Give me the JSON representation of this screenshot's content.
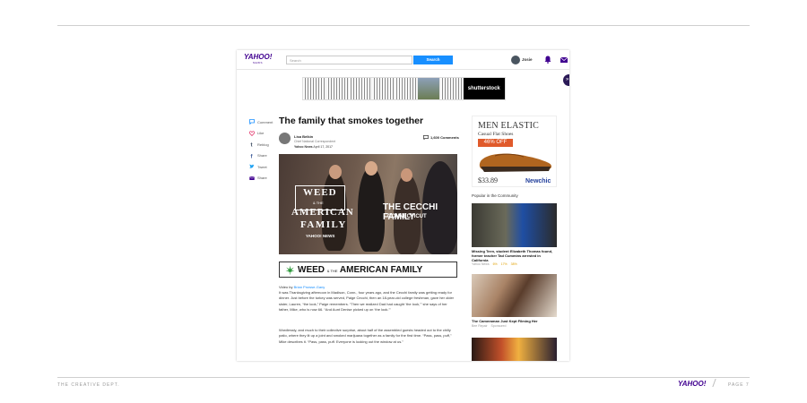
{
  "slide": {
    "footer_left": "THE CREATIVE DEPT.",
    "footer_logo": "YAHOO!",
    "footer_page": "PAGE 7"
  },
  "topbar": {
    "logo": "YAHOO!",
    "logo_sub": "NEWS",
    "search_placeholder": "Search",
    "search_button": "Search",
    "username": "Josie",
    "icons": [
      "bell-icon",
      "mail-icon"
    ]
  },
  "ad_banner": {
    "brand": "shutterstock",
    "close": "»"
  },
  "social": [
    {
      "label": "Comment",
      "icon": "comment-icon",
      "color": "#188fff"
    },
    {
      "label": "Like",
      "icon": "heart-icon",
      "color": "#e0245e"
    },
    {
      "label": "Reblog",
      "icon": "tumblr-icon",
      "color": "#36465d"
    },
    {
      "label": "Share",
      "icon": "facebook-icon",
      "color": "#3b5998"
    },
    {
      "label": "Tweet",
      "icon": "twitter-icon",
      "color": "#1da1f2"
    },
    {
      "label": "Share",
      "icon": "email-icon",
      "color": "#400090"
    }
  ],
  "article": {
    "title": "The family that smokes together",
    "author": "Lisa Belkin",
    "author_title": "Chief National Correspondent",
    "publisher": "Yahoo News",
    "date": "April 17, 2017",
    "comments": "1,600 Comments",
    "video": {
      "weed": "WEED",
      "the_and": "& THE",
      "american": "AMERICAN",
      "family": "FAMILY",
      "brand": "YAHOO! NEWS",
      "episode_title": "THE CECCHI FAMILY",
      "episode_location": "CONNECTICUT"
    },
    "banner": {
      "weed": "WEED",
      "and_the": "& THE",
      "rest": "AMERICAN FAMILY"
    },
    "video_by_prefix": "Video by ",
    "video_by_name": "Brian Prowse-Gany",
    "paragraphs": [
      "It was Thanksgiving afternoon in Madison, Conn., four years ago, and the Cecchi family was getting ready for dinner. Just before the turkey was served, Paige Cecchi, then an 18-year-old college freshman, gave her older sister, Lauren, “the look,” Paige remembers. “Then we realized Dad had caught ‘the look,’” she says of her father, Mike, who is now 66. “And Aunt Denise picked up on ‘the look.’”",
      "Wordlessly, and much to their collective surprise, about half of the assembled guests headed out to the chilly patio, where they lit up a joint and smoked marijuana together as a family for the first time. “Pass, pass, puff,” Mike describes it. “Pass, pass, puff. Everyone is looking out the window at us.”"
    ]
  },
  "right_ad": {
    "headline": "MEN ELASTIC",
    "subhead": "Casual Flat Shoes",
    "discount": "46% OFF",
    "price": "$33.89",
    "brand": "Newchic"
  },
  "popular": {
    "heading": "Popular in the Community",
    "items": [
      {
        "title": "Missing Teen, student Elizabeth Thomas found, former teacher Tad Cummins arrested in California",
        "source": "Yahoo News",
        "reactions": [
          "6%",
          "17%",
          "38%"
        ]
      },
      {
        "title": "The Cameraman Just Kept Filming Her",
        "source": "Bee Repair",
        "sponsored": "Sponsored"
      }
    ]
  }
}
